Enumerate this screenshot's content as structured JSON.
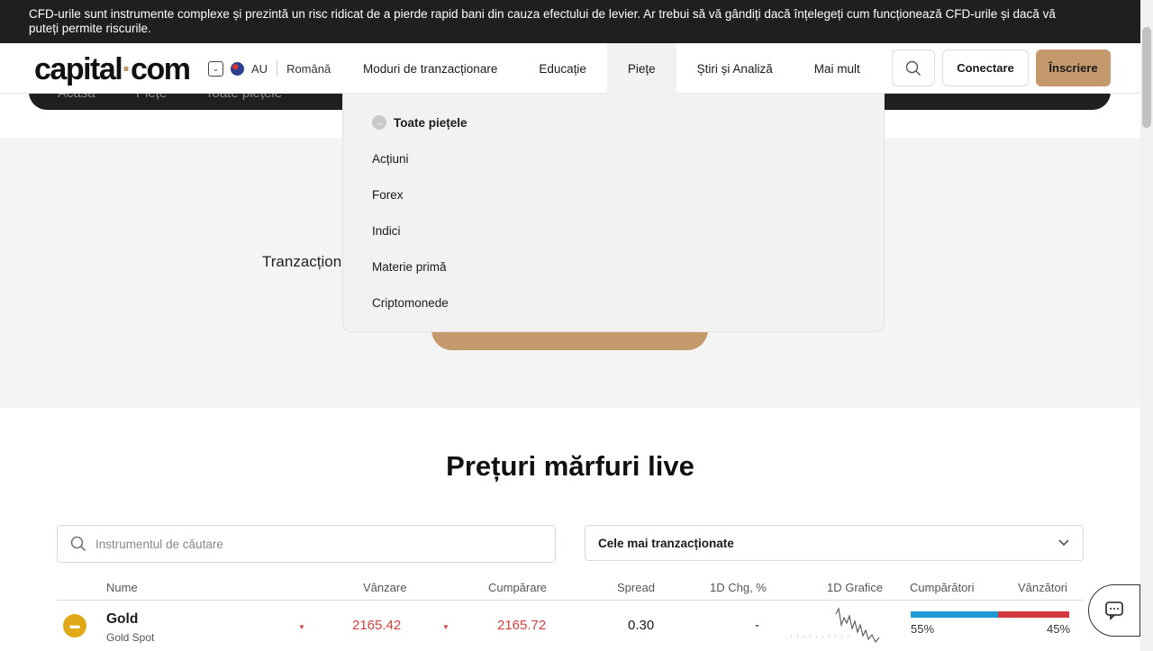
{
  "risk_warning": "CFD-urile sunt instrumente complexe și prezintă un risc ridicat de a pierde rapid bani din cauza efectului de levier. Ar trebui să vă gândiți dacă înțelegeți cum funcționează CFD-urile și dacă vă puteți permite riscurile.",
  "logo": {
    "part1": "capital",
    "dot": "·",
    "part2": "com"
  },
  "region": {
    "country": "AU",
    "language": "Română"
  },
  "nav": {
    "items": [
      "Moduri de tranzacționare",
      "Educație",
      "Piețe",
      "Știri și Analiză",
      "Mai mult"
    ],
    "active_index": 2
  },
  "header": {
    "login_label": "Conectare",
    "signup_label": "Înscriere"
  },
  "breadcrumb": [
    "Acasă",
    "Piețe",
    "Toate piețele"
  ],
  "hero": {
    "text": "Tranzacționați"
  },
  "markets_menu": {
    "all_label": "Toate piețele",
    "items": [
      "Acțiuni",
      "Forex",
      "Indici",
      "Materie primă",
      "Criptomonede"
    ]
  },
  "section": {
    "title": "Prețuri mărfuri live",
    "search_placeholder": "Instrumentul de căutare",
    "sort_value": "Cele mai tranzacționate"
  },
  "table": {
    "columns": [
      "Nume",
      "Vânzare",
      "Cumpărare",
      "Spread",
      "1D Chg, %",
      "1D Grafice",
      "Cumpărători",
      "Vânzători"
    ],
    "rows": [
      {
        "name": "Gold",
        "subtitle": "Gold Spot",
        "sell": "2165.42",
        "buy": "2165.72",
        "spread": "0.30",
        "change": "-",
        "buyers_pct": "55%",
        "sellers_pct": "45%",
        "buyers_fraction": 0.55
      }
    ]
  },
  "colors": {
    "accent": "#c4996c",
    "dark": "#1f1f1f",
    "buy": "#1e9bd7",
    "sell": "#d6393d",
    "down": "#d43f3f"
  },
  "icons": [
    "search-icon",
    "chevron-down-icon",
    "arrow-right-icon",
    "gold-icon",
    "chat-icon"
  ]
}
